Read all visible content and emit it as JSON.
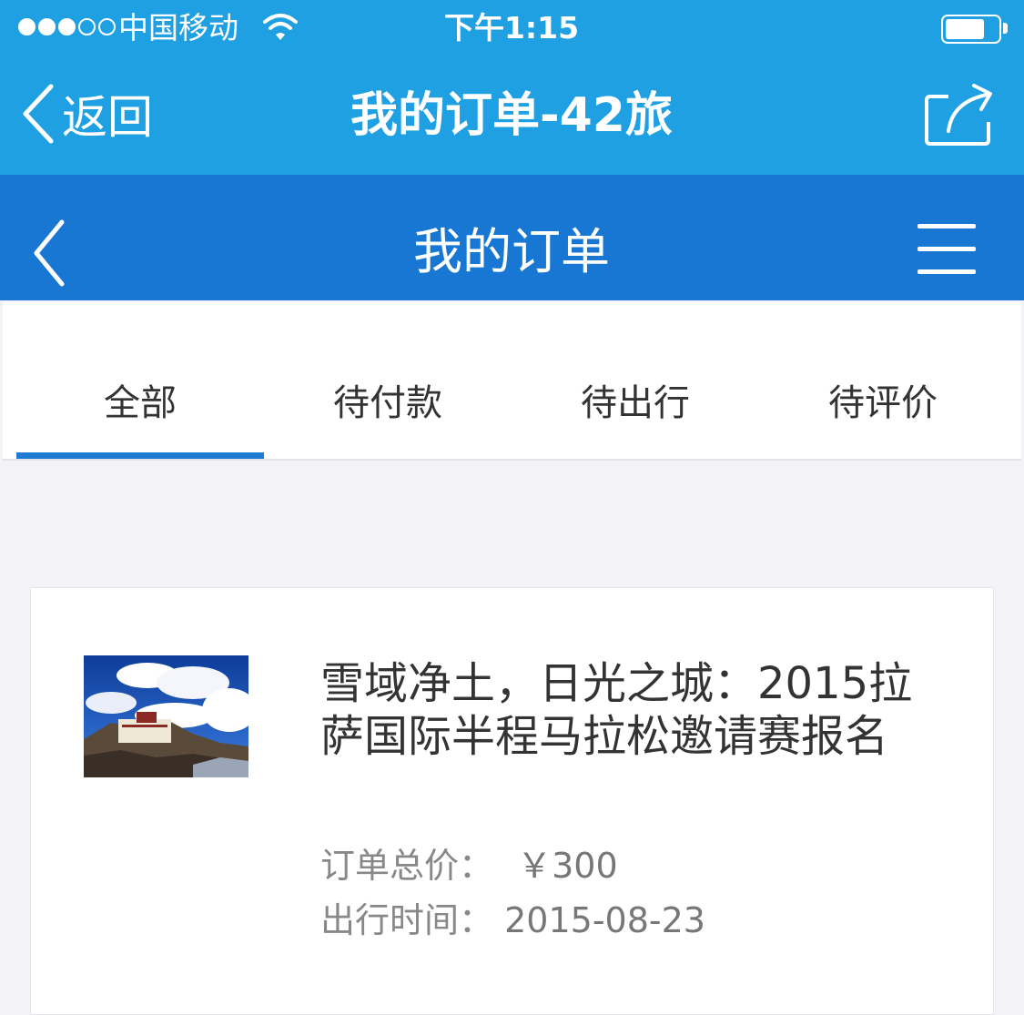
{
  "status_bar": {
    "carrier": "中国移动",
    "time": "下午1:15",
    "signal_filled": 3,
    "signal_total": 5,
    "battery_level": 0.75
  },
  "nav": {
    "back_label": "返回",
    "title": "我的订单-42旅",
    "share_icon": "share-icon"
  },
  "page_header": {
    "title": "我的订单",
    "back_icon": "chevron-left-icon",
    "menu_icon": "hamburger-menu-icon"
  },
  "tabs": [
    {
      "label": "全部",
      "active": true
    },
    {
      "label": "待付款",
      "active": false
    },
    {
      "label": "待出行",
      "active": false
    },
    {
      "label": "待评价",
      "active": false
    }
  ],
  "order": {
    "title": "雪域净土，日光之城：2015拉萨国际半程马拉松邀请赛报名",
    "price_label": "订单总价：",
    "price_value": "￥300",
    "date_label": "出行时间：",
    "date_value": "2015-08-23"
  },
  "colors": {
    "top_bar": "#1ea0e3",
    "page_header": "#1877d2",
    "tab_active": "#1e7ad0",
    "background": "#f3f2f7"
  }
}
